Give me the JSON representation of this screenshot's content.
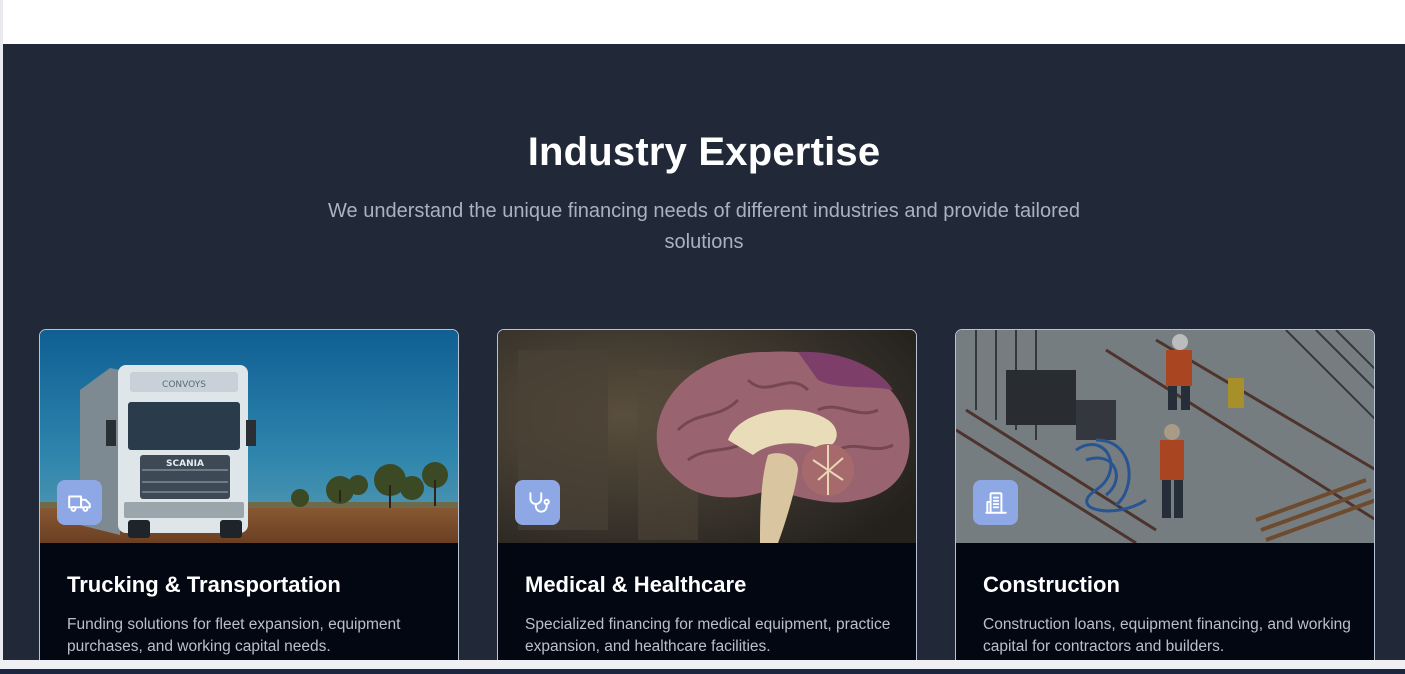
{
  "section": {
    "title": "Industry Expertise",
    "subtitle": "We understand the unique financing needs of different industries and provide tailored solutions"
  },
  "cards": [
    {
      "title": "Trucking & Transportation",
      "description": "Funding solutions for fleet expansion, equipment purchases, and working capital needs.",
      "icon": "truck-icon",
      "image": "semi-truck-photo"
    },
    {
      "title": "Medical & Healthcare",
      "description": "Specialized financing for medical equipment, practice expansion, and healthcare facilities.",
      "icon": "stethoscope-icon",
      "image": "brain-model-photo"
    },
    {
      "title": "Construction",
      "description": "Construction loans, equipment financing, and working capital for contractors and builders.",
      "icon": "building-icon",
      "image": "construction-site-photo"
    }
  ],
  "colors": {
    "section_bg": "#212938",
    "card_bg": "#030712",
    "icon_badge": "#8ea8e6",
    "heading": "#ffffff",
    "subtitle": "#aab2c0"
  }
}
